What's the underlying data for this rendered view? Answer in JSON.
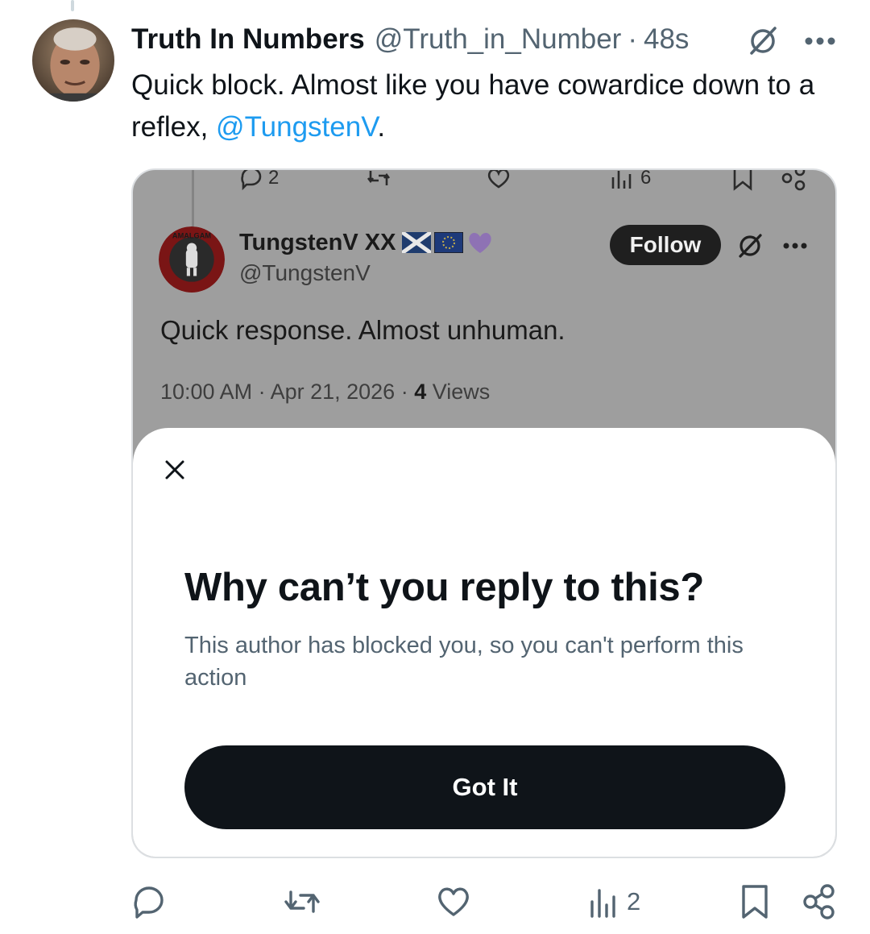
{
  "tweet": {
    "author_name": "Truth In Numbers",
    "author_handle": "@Truth_in_Number",
    "separator": "·",
    "time": "48s",
    "text_before": "Quick block. Almost like you have cowardice down to a reflex, ",
    "mention": "@TungstenV",
    "text_after": "."
  },
  "embedded": {
    "top_actions": {
      "reply_count": "2",
      "views_count": "6"
    },
    "author_name": "TungstenV XX",
    "author_handle": "@TungstenV",
    "avatar_ring_text": "AMALGAM",
    "follow_label": "Follow",
    "text": "Quick response. Almost unhuman.",
    "timestamp": "10:00 AM · Apr 21, 2026 · ",
    "views_count": "4",
    "views_label": " Views"
  },
  "sheet": {
    "title": "Why can’t you reply to this?",
    "body": "This author has blocked you, so you can't perform this action",
    "button_label": "Got It"
  },
  "actions": {
    "views_count": "2"
  },
  "icons": [
    "reply-icon",
    "retweet-icon",
    "like-icon",
    "views-icon",
    "bookmark-icon",
    "share-icon",
    "grok-icon",
    "more-icon",
    "close-icon"
  ],
  "colors": {
    "accent": "#1d9bf0",
    "text_primary": "#0f1419",
    "text_secondary": "#536471",
    "dim_overlay": "#9e9e9e"
  }
}
